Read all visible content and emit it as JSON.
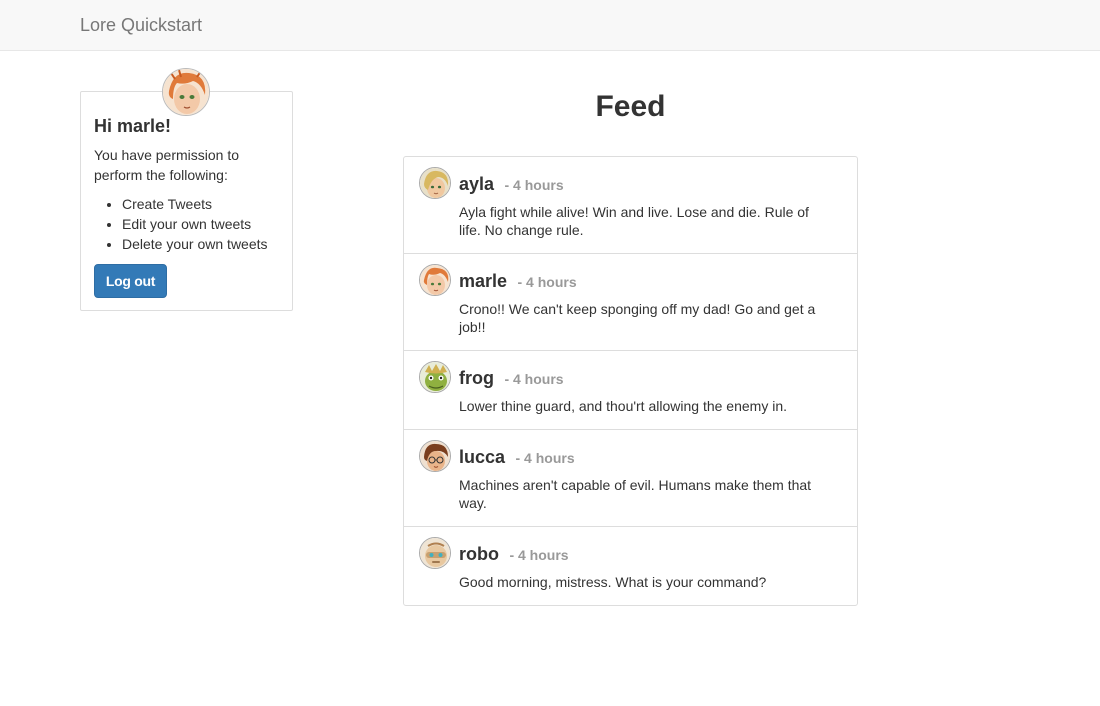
{
  "navbar": {
    "brand": "Lore Quickstart"
  },
  "profile": {
    "greeting": "Hi marle!",
    "intro": "You have permission to perform the following:",
    "permissions": [
      "Create Tweets",
      "Edit your own tweets",
      "Delete your own tweets"
    ],
    "logout_label": "Log out",
    "avatar_icon": "marle-avatar"
  },
  "feed": {
    "title": "Feed",
    "tweets": [
      {
        "user": "ayla",
        "time": "- 4 hours",
        "text": "Ayla fight while alive! Win and live. Lose and die. Rule of life. No change rule.",
        "avatar_icon": "ayla-avatar",
        "hair": "#d8b860",
        "skin": "#f0c8a0"
      },
      {
        "user": "marle",
        "time": "- 4 hours",
        "text": "Crono!! We can't keep sponging off my dad! Go and get a job!!",
        "avatar_icon": "marle-avatar",
        "hair": "#e07a3a",
        "skin": "#f3c9a8"
      },
      {
        "user": "frog",
        "time": "- 4 hours",
        "text": "Lower thine guard, and thou'rt allowing the enemy in.",
        "avatar_icon": "frog-avatar",
        "hair": "#d0b050",
        "skin": "#8fb040"
      },
      {
        "user": "lucca",
        "time": "- 4 hours",
        "text": "Machines aren't capable of evil. Humans make them that way.",
        "avatar_icon": "lucca-avatar",
        "hair": "#7a3e1e",
        "skin": "#e9b48a"
      },
      {
        "user": "robo",
        "time": "- 4 hours",
        "text": "Good morning, mistress. What is your command?",
        "avatar_icon": "robo-avatar",
        "hair": "#c8a070",
        "skin": "#e8c8a0"
      }
    ]
  },
  "colors": {
    "primary": "#337ab7",
    "navbar_bg": "#f8f8f8",
    "muted": "#999999",
    "border": "#dddddd"
  }
}
